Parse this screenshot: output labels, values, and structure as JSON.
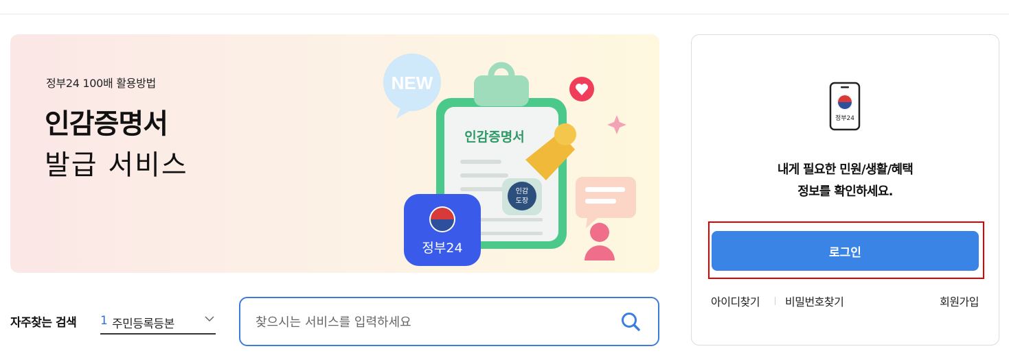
{
  "banner": {
    "subtitle": "정부24 100배 활용방법",
    "title_line1": "인감증명서",
    "title_line2": "발급 서비스",
    "illustration": {
      "bubble_text": "NEW",
      "doc_title": "인감증명서",
      "stamp_text_1": "인감",
      "stamp_text_2": "도장",
      "app_label": "정부24"
    }
  },
  "search": {
    "frequent_label": "자주찾는 검색",
    "frequent_rank": "1",
    "frequent_item": "주민등록등본",
    "placeholder": "찾으시는 서비스를 입력하세요"
  },
  "login_card": {
    "phone_label": "정부24",
    "message_line1": "내게 필요한 민원/생활/혜택",
    "message_line2": "정보를 확인하세요.",
    "login_label": "로그인",
    "find_id": "아이디찾기",
    "find_password": "비밀번호찾기",
    "signup": "회원가입"
  },
  "colors": {
    "accent_blue": "#3a84e6",
    "highlight_red": "#e00000",
    "search_border": "#3c7bd9"
  }
}
